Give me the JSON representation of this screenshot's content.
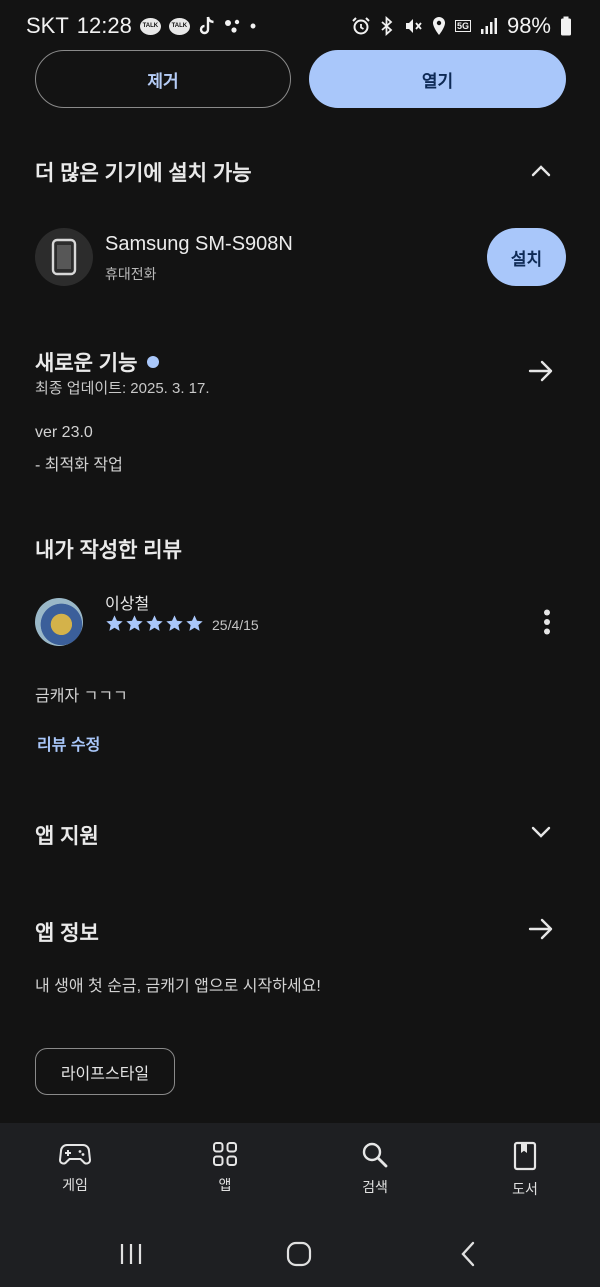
{
  "status_bar": {
    "carrier": "SKT",
    "time": "12:28",
    "talk_badge_1": "TALK",
    "talk_badge_2": "TALK",
    "separator": "•",
    "network_badge": "5G",
    "battery": "98%"
  },
  "actions": {
    "remove_label": "제거",
    "open_label": "열기"
  },
  "more_devices": {
    "title": "더 많은 기기에 설치 가능",
    "device_name": "Samsung SM-S908N",
    "device_type": "휴대전화",
    "install_label": "설치"
  },
  "whats_new": {
    "title": "새로운 기능",
    "updated": "최종 업데이트: 2025. 3. 17.",
    "version": "ver 23.0",
    "notes": "- 최적화 작업"
  },
  "my_review": {
    "title": "내가 작성한 리뷰",
    "reviewer": "이상철",
    "rating": 5,
    "date": "25/4/15",
    "text": "금캐자 ㄱㄱㄱ",
    "edit_label": "리뷰 수정"
  },
  "app_support": {
    "title": "앱 지원"
  },
  "app_info": {
    "title": "앱 정보",
    "description": "내 생애 첫 순금, 금캐기 앱으로 시작하세요!",
    "category_chip": "라이프스타일"
  },
  "bottom_nav": {
    "games": "게임",
    "apps": "앱",
    "search": "검색",
    "books": "도서"
  },
  "colors": {
    "accent": "#a9c7fa",
    "background": "#131313",
    "nav_background": "#1e1f22"
  }
}
